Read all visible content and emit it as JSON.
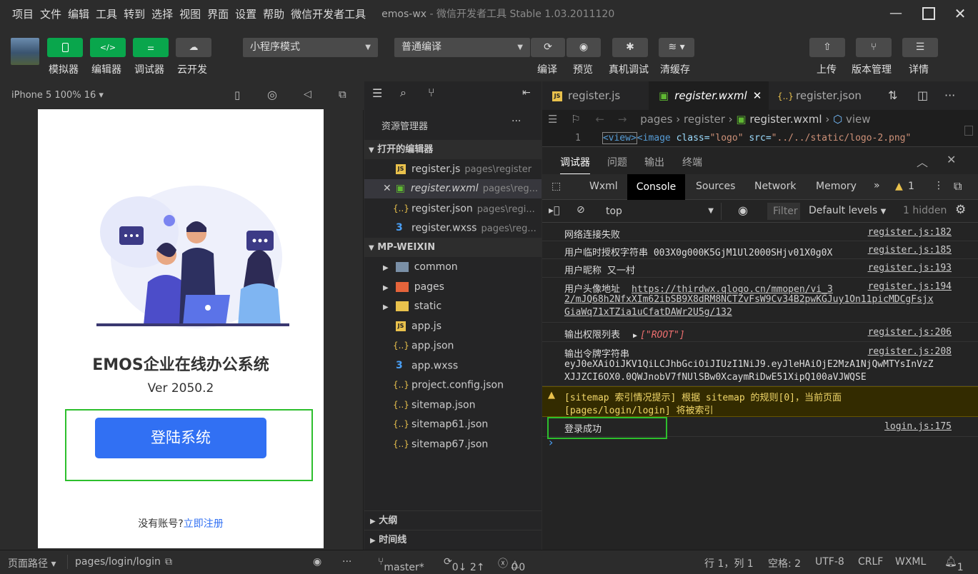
{
  "menu": {
    "items": [
      "项目",
      "文件",
      "编辑",
      "工具",
      "转到",
      "选择",
      "视图",
      "界面",
      "设置",
      "帮助",
      "微信开发者工具"
    ],
    "app_title": "emos-wx",
    "window_title": " - 微信开发者工具 Stable 1.03.2011120"
  },
  "toolbar": {
    "simulator": "模拟器",
    "editor": "编辑器",
    "debugger": "调试器",
    "cloud": "云开发",
    "mode_select": "小程序模式",
    "compile_select": "普通编译",
    "compile": "编译",
    "preview": "预览",
    "real_debug": "真机调试",
    "clear_cache": "清缓存",
    "upload": "上传",
    "version": "版本管理",
    "details": "详情"
  },
  "simulator": {
    "device": "iPhone 5 100% 16 ▾",
    "app_name": "EMOS企业在线办公系统",
    "version": "Ver 2050.2",
    "login_button": "登陆系统",
    "no_account": "没有账号?",
    "register_link": "立即注册"
  },
  "explorer": {
    "title": "资源管理器",
    "open_editors": "打开的编辑器",
    "open_files": [
      {
        "name": "register.js",
        "dir": "pages\\register"
      },
      {
        "name": "register.wxml",
        "dir": "pages\\reg..."
      },
      {
        "name": "register.json",
        "dir": "pages\\regi..."
      },
      {
        "name": "register.wxss",
        "dir": "pages\\reg..."
      }
    ],
    "project": "MP-WEIXIN",
    "folders": [
      "common",
      "pages",
      "static"
    ],
    "files": [
      "app.js",
      "app.json",
      "app.wxss",
      "project.config.json",
      "sitemap.json",
      "sitemap61.json",
      "sitemap67.json"
    ],
    "outline": "大纲",
    "timeline": "时间线"
  },
  "editor": {
    "tabs": [
      "register.js",
      "register.wxml",
      "register.json"
    ],
    "breadcrumb": [
      "pages",
      "register",
      "register.wxml",
      "view"
    ],
    "line_no": "1",
    "code": {
      "tag_open": "<view>",
      "tag_image": "<image ",
      "attr_class": "class=",
      "val_class": "\"logo\"",
      "attr_src": " src=",
      "val_src": "\"../../static/logo-2.png\""
    }
  },
  "devtools": {
    "top_tabs": [
      "调试器",
      "问题",
      "输出",
      "终端"
    ],
    "panels": [
      "Wxml",
      "Console",
      "Sources",
      "Network",
      "Memory"
    ],
    "warning_count": "1",
    "context": "top",
    "filter_placeholder": "Filter",
    "levels": "Default levels",
    "hidden": "1 hidden",
    "logs": [
      {
        "msg": "网络连接失败",
        "src": "register.js:182"
      },
      {
        "msg": "用户临时授权字符串 003X0g000K5GjM1Ul2000SHjv01X0g0X",
        "src": "register.js:185"
      },
      {
        "msg": "用户昵称  又一村",
        "src": "register.js:193"
      },
      {
        "msg": "用户头像地址",
        "url1": "https://thirdwx.qlogo.cn/mmopen/vi_3",
        "url2": "2/mJQ68h2NfxXIm62ibSB9X8dRM8NCTZvFsW9Cv34B2pwKGJuy1On11picMDCgFsjx",
        "url3": "GiaWq71xTZia1uCfatDAWr2U5g/132",
        "src": "register.js:194"
      },
      {
        "msg": "输出权限列表",
        "arr": "[\"ROOT\"]",
        "src": "register.js:206"
      },
      {
        "msg": "输出令牌字符串",
        "token1": "eyJ0eXAiOiJKV1QiLCJhbGciOiJIUzI1NiJ9.eyJleHAiOjE2MzA1NjQwMTYsInVzZ",
        "token2": "XJJZCI6OX0.0QWJnobV7fNUlSBw0XcaymRiDwE51XipQ100aVJWQSE",
        "src": "register.js:208"
      },
      {
        "msg1": "[sitemap 索引情况提示] 根据 sitemap 的规则[0]，当前页面",
        "msg2": "[pages/login/login] 将被索引"
      },
      {
        "msg": "登录成功",
        "src": "login.js:175"
      }
    ],
    "prompt": "›"
  },
  "status": {
    "page_path_label": "页面路径 ▾",
    "page_path": "pages/login/login",
    "branch": "master*",
    "sync": "0↓ 2↑",
    "errors": "0",
    "warnings": "0",
    "position": "行 1，列 1",
    "spaces": "空格: 2",
    "encoding": "UTF-8",
    "eol": "CRLF",
    "lang": "WXML",
    "bell": "1"
  }
}
